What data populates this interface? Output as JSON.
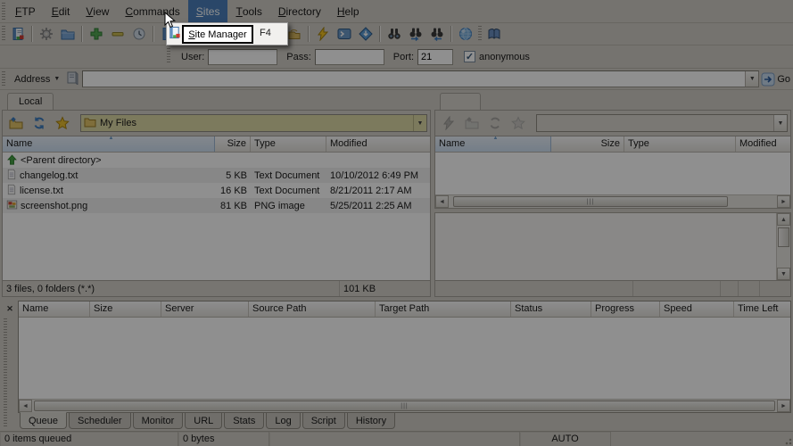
{
  "menu_bar": {
    "items": [
      "FTP",
      "Edit",
      "View",
      "Commands",
      "Sites",
      "Tools",
      "Directory",
      "Help"
    ],
    "active_item": "Sites"
  },
  "menu_popup": {
    "label": "Site Manager",
    "shortcut": "F4"
  },
  "toolbar": {
    "icons": [
      "site-manager",
      "options-gear",
      "folder",
      "add-green-plus",
      "remove-minus",
      "clock",
      "site-manager-2",
      "transfer-hand",
      "quick-connect-lightning",
      "console",
      "download-diamond",
      "find-binoculars",
      "find-next-binoculars",
      "find-prev-binoculars",
      "globe",
      "help-book"
    ]
  },
  "quick_connect": {
    "user_label": "User:",
    "user_value": "",
    "pass_label": "Pass:",
    "pass_value": "",
    "port_label": "Port:",
    "port_value": "21",
    "anonymous_label": "anonymous",
    "anonymous_checked": "true"
  },
  "address_bar": {
    "label": "Address",
    "value": "",
    "go_label": "Go"
  },
  "local_panel": {
    "tab_label": "Local",
    "toolbar_icons": [
      "folder-up",
      "refresh",
      "favorites-star"
    ],
    "path_value": "My Files",
    "columns": [
      "Name",
      "Size",
      "Type",
      "Modified"
    ],
    "rows": [
      {
        "name": "<Parent directory>",
        "size": "",
        "type": "",
        "modified": "",
        "icon": "parent-up-arrow"
      },
      {
        "name": "changelog.txt",
        "size": "5 KB",
        "type": "Text Document",
        "modified": "10/10/2012 6:49 PM",
        "icon": "text-document"
      },
      {
        "name": "license.txt",
        "size": "16 KB",
        "type": "Text Document",
        "modified": "8/21/2011 2:17 AM",
        "icon": "text-document"
      },
      {
        "name": "screenshot.png",
        "size": "81 KB",
        "type": "PNG image",
        "modified": "5/25/2011 2:25 AM",
        "icon": "png-image"
      }
    ],
    "status_left": "3 files, 0 folders (*.*)",
    "status_right": "101 KB"
  },
  "remote_panel": {
    "tab_label": "",
    "toolbar_icons": [
      "disconnect",
      "folder-up",
      "refresh",
      "favorites-star"
    ],
    "path_value": "",
    "columns": [
      "Name",
      "Size",
      "Type",
      "Modified"
    ]
  },
  "queue_panel": {
    "columns": [
      "Name",
      "Size",
      "Server",
      "Source Path",
      "Target Path",
      "Status",
      "Progress",
      "Speed",
      "Time Left"
    ],
    "tabs": [
      "Queue",
      "Scheduler",
      "Monitor",
      "URL",
      "Stats",
      "Log",
      "Script",
      "History"
    ],
    "active_tab": "Queue"
  },
  "status_bar": {
    "queued": "0 items queued",
    "bytes": "0 bytes",
    "mode": "AUTO"
  },
  "colors": {
    "menu_highlight": "#4b7fbc",
    "path_highlight": "#ded9a6",
    "sorted_column": "#cfe1f3"
  }
}
